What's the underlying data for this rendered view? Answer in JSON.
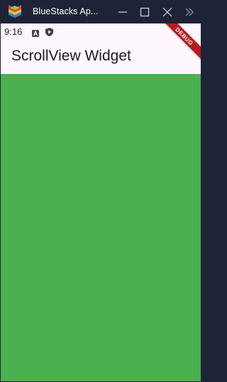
{
  "window": {
    "title": "BlueStacks Ap..."
  },
  "status_bar": {
    "time": "9:16"
  },
  "app_bar": {
    "title": "ScrollView Widget"
  },
  "debug_banner": {
    "label": "DEBUG"
  },
  "colors": {
    "titlebar_bg": "#1f2337",
    "appbar_bg": "#fdf6fd",
    "content_bg": "#4caf50",
    "debug_ribbon": "#b71c1c"
  }
}
